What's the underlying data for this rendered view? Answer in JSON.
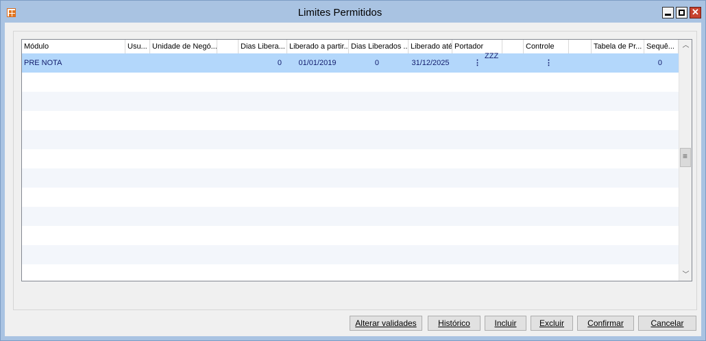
{
  "window": {
    "title": "Limites Permitidos"
  },
  "grid": {
    "columns": [
      "Módulo",
      "Usu...",
      "Unidade de Negó...",
      "",
      "Dias Libera...",
      "Liberado a partir...",
      "Dias Liberados ...",
      "Liberado até",
      "Portador",
      "",
      "Controle",
      "",
      "Tabela de Pr...",
      "Sequê..."
    ],
    "rows": [
      {
        "modulo": "PRE NOTA",
        "dias_liberados": "0",
        "liberado_a_partir": "01/01/2019",
        "dias_liberados_2": "0",
        "liberado_ate": "31/12/2025",
        "portador_mark": "⋮",
        "overlay": "ZZZ",
        "controle_mark": "⋮",
        "sequencia": "0"
      }
    ]
  },
  "buttons": {
    "alterar": "Alterar validades",
    "historico": "Histórico",
    "incluir": "Incluir",
    "excluir": "Excluir",
    "confirmar": "Confirmar",
    "cancelar": "Cancelar"
  },
  "icons": {
    "app": "app-logo-icon",
    "minimize": "minimize-icon",
    "maximize": "maximize-icon",
    "close": "close-icon"
  },
  "colors": {
    "titlebar": "#a9c3e2",
    "selected_row": "#b3d7fb",
    "close_button": "#c7432f"
  }
}
